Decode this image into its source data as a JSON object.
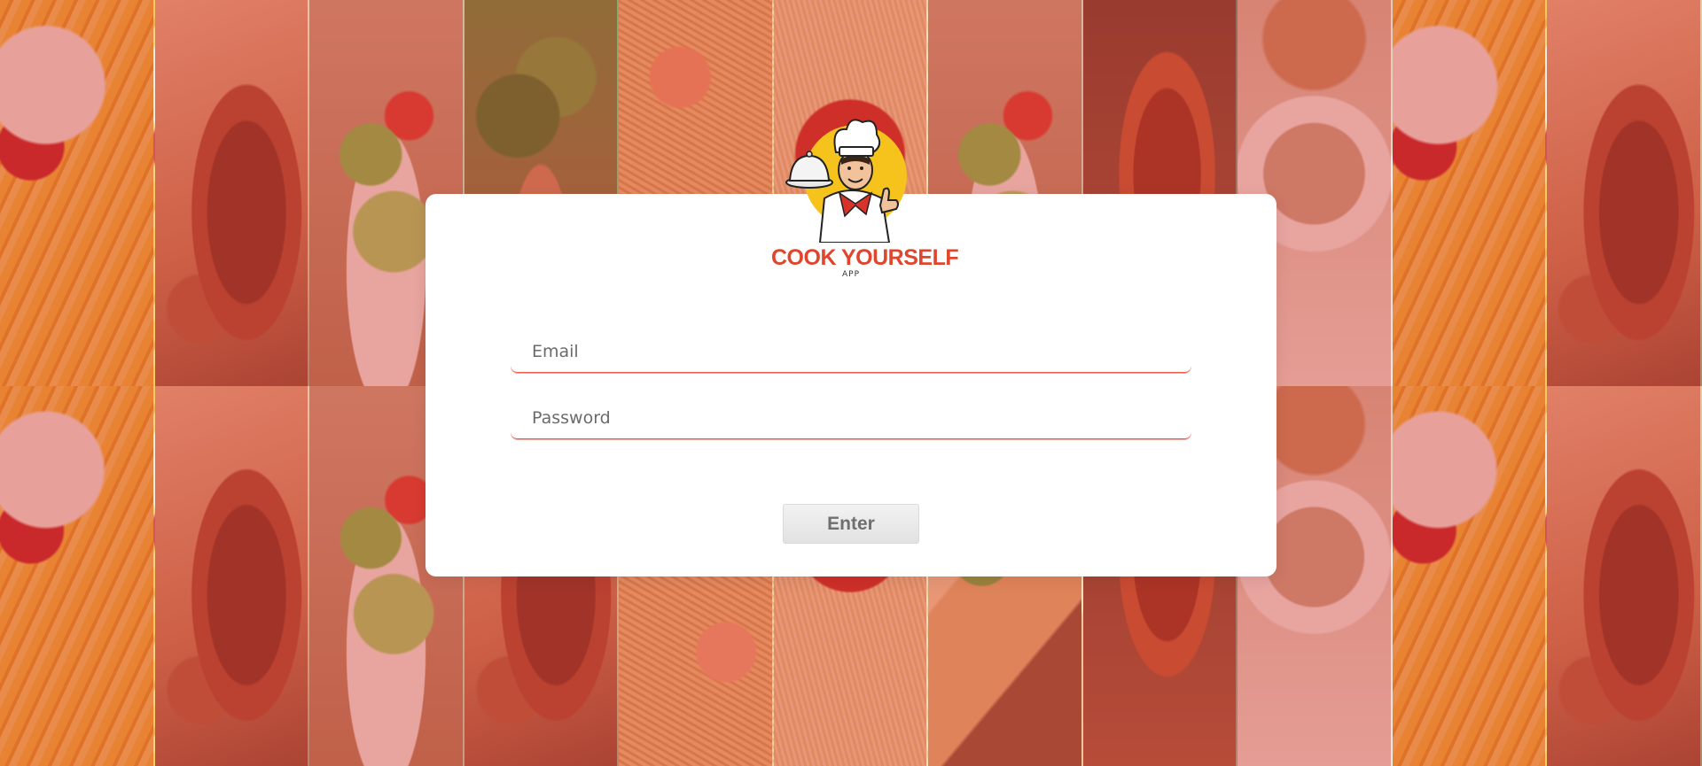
{
  "background": {
    "tiles_row1": [
      "fries",
      "steak",
      "salad",
      "broccoli",
      "shrimp",
      "pasta",
      "salad",
      "chicken",
      "coffee",
      "fries",
      "steak"
    ],
    "tiles_row2": [
      "fries",
      "steak",
      "salad",
      "steak",
      "shrimp",
      "pasta",
      "taco",
      "chicken",
      "coffee",
      "fries",
      "steak"
    ],
    "overlay_color": "#d63c37"
  },
  "logo": {
    "icon": "chef-mascot-icon",
    "brand": "COOK YOURSELF",
    "subtitle": "APP",
    "brand_color": "#e0462d",
    "badge_color": "#f6c21c"
  },
  "form": {
    "email_placeholder": "Email",
    "password_placeholder": "Password",
    "submit_label": "Enter",
    "accent_color": "#ef5b4d"
  }
}
